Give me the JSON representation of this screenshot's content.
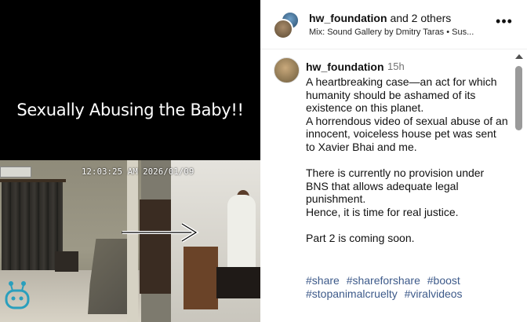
{
  "video": {
    "overlay_title": "Sexually Abusing the Baby!!",
    "timestamp": "12:03:25 AM 2026/01/09"
  },
  "header": {
    "author": "hw_foundation",
    "others": "and 2 others",
    "audio": "Mix: Sound Gallery by Dmitry Taras • Sus...",
    "more_icon": "more-horizontal-icon"
  },
  "comment": {
    "username": "hw_foundation",
    "time": "15h",
    "paragraphs": [
      "A heartbreaking case—an act for which humanity should be ashamed of its existence on this planet.",
      "A horrendous video of sexual abuse of an innocent, voiceless house pet was sent to Xavier Bhai and me.",
      "There is currently no provision under BNS that allows adequate legal punishment.",
      "Hence, it is time for real justice.",
      "Part 2 is coming soon."
    ],
    "hashtags": [
      "#share",
      "#shareforshare",
      "#boost",
      "#stopanimalcruelty",
      "#viralvideos"
    ]
  },
  "colors": {
    "hashtag": "#3d5a8a",
    "timestamp_text": "#737373"
  }
}
